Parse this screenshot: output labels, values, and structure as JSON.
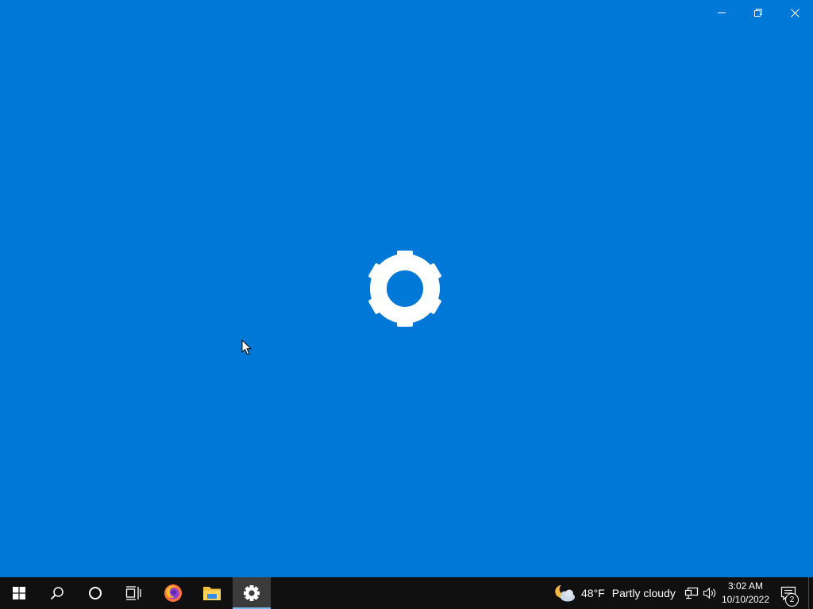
{
  "window": {
    "minimize_label": "Minimize",
    "restore_label": "Restore Down",
    "close_label": "Close"
  },
  "splash": {
    "background": "#0078d7",
    "icon": "gear-icon"
  },
  "taskbar": {
    "apps": [
      {
        "name": "Start",
        "icon": "windows-logo-icon"
      },
      {
        "name": "Search",
        "icon": "search-icon"
      },
      {
        "name": "Cortana",
        "icon": "cortana-circle-icon"
      },
      {
        "name": "Task View",
        "icon": "task-view-icon"
      },
      {
        "name": "Firefox",
        "icon": "firefox-icon"
      },
      {
        "name": "File Explorer",
        "icon": "folder-icon"
      },
      {
        "name": "Settings",
        "icon": "gear-icon",
        "active": true
      }
    ],
    "weather": {
      "temperature": "48°F",
      "condition": "Partly cloudy",
      "icon": "moon-cloud-icon"
    },
    "tray": {
      "network_icon": "network-icon",
      "volume_icon": "volume-icon"
    },
    "clock": {
      "time": "3:02 AM",
      "date": "10/10/2022"
    },
    "notifications": {
      "count": "2",
      "icon": "action-center-icon"
    }
  },
  "colors": {
    "accent": "#0078d7",
    "taskbar": "#101010",
    "active_underline": "#76b9ed"
  }
}
